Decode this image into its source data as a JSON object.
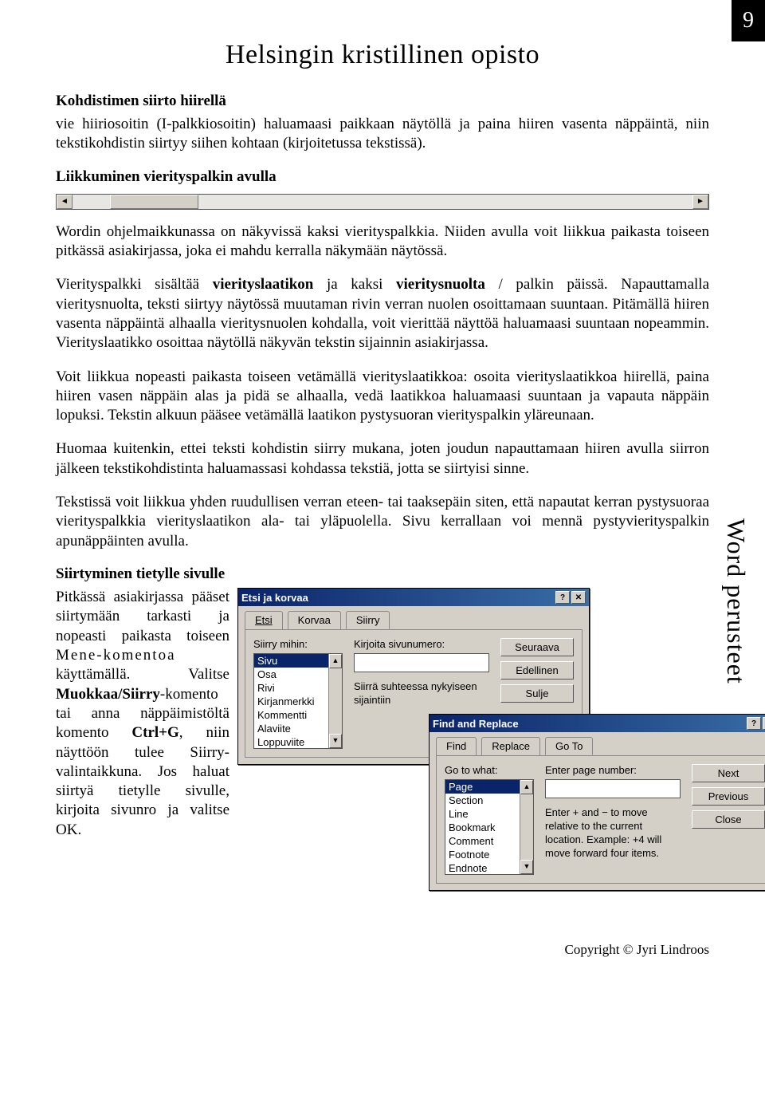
{
  "header": {
    "title": "Helsingin kristillinen opisto",
    "pageNumber": "9"
  },
  "sideText": "Word perusteet",
  "h1": "Kohdistimen siirto hiirellä",
  "p1": "vie hiiriosoitin (I-palkkiosoitin) haluamaasi paikkaan näytöllä ja paina hiiren vasenta näppäintä, niin tekstikohdistin siirtyy siihen kohtaan (kirjoitetussa tekstissä).",
  "h2": "Liikkuminen vierityspalkin avulla",
  "p2": "Wordin ohjelmaikkunassa on näkyvissä kaksi vierityspalkkia. Niiden avulla voit liikkua paikasta toiseen pitkässä asiakirjassa, joka ei mahdu kerralla näkymään näytössä.",
  "p3a": "Vierityspalkki sisältää ",
  "p3b": "vierityslaatikon",
  "p3c": "  ja kaksi ",
  "p3d": "vieritysnuolta",
  "p3e": "  / palkin päissä. Napauttamalla vieritysnuolta, teksti siirtyy näytössä muutaman rivin verran nuolen osoittamaan suuntaan. Pitämällä hiiren vasenta näppäintä alhaalla vieritysnuolen kohdalla, voit vierittää näyttöä haluamaasi suuntaan nopeammin. Vierityslaatikko osoittaa näytöllä näkyvän tekstin sijainnin asiakirjassa.",
  "p4": "Voit liikkua nopeasti paikasta toiseen vetämällä vierityslaatikkoa: osoita vierityslaatikkoa hiirellä, paina hiiren vasen näppäin alas ja pidä se alhaalla, vedä laatikkoa haluamaasi suuntaan ja vapauta näppäin lopuksi. Tekstin alkuun pääsee vetämällä laatikon pystysuoran vierityspalkin yläreunaan.",
  "p5": "Huomaa kuitenkin, ettei teksti kohdistin siirry mukana, joten joudun napauttamaan hiiren avulla siirron jälkeen tekstikohdistinta haluamassasi kohdassa tekstiä, jotta se siirtyisi sinne.",
  "p6": "Tekstissä voit liikkua yhden ruudullisen verran eteen- tai taaksepäin siten, että napautat kerran pystysuoraa vierityspalkkia vierityslaatikon ala- tai yläpuolella. Sivu kerrallaan voi mennä pystyvierityspalkin apunäppäinten  avulla.",
  "h3": "Siirtyminen tietylle sivulle",
  "left1": "Pitkässä asiakirjassa pääset siirtymään tarkasti ja nopeasti paikasta toiseen ",
  "left1b": "Mene-komentoa",
  "left1c": " käyttämällä. Valitse ",
  "left1d": "Muokkaa/Siirry",
  "left1e": "-komento tai anna näppäimistöltä komento ",
  "left1f": "Ctrl+G",
  "left1g": ", niin näyttöön tulee Siirry-valintaikkuna. Jos haluat siirtyä tietylle sivulle, kirjoita sivunro ja valitse OK.",
  "dlgFi": {
    "title": "Etsi ja korvaa",
    "tabs": [
      "Etsi",
      "Korvaa",
      "Siirry"
    ],
    "goLabel": "Siirry mihin:",
    "items": [
      "Sivu",
      "Osa",
      "Rivi",
      "Kirjanmerkki",
      "Kommentti",
      "Alaviite",
      "Loppuviite"
    ],
    "numLabel": "Kirjoita sivunumero:",
    "hint": "Siirrä suhteessa nykyiseen sijaintiin",
    "btnNext": "Seuraava",
    "btnPrev": "Edellinen",
    "btnClose": "Sulje"
  },
  "dlgEn": {
    "title": "Find and Replace",
    "tabs": [
      "Find",
      "Replace",
      "Go To"
    ],
    "goLabel": "Go to what:",
    "items": [
      "Page",
      "Section",
      "Line",
      "Bookmark",
      "Comment",
      "Footnote",
      "Endnote"
    ],
    "numLabel": "Enter page number:",
    "hint": "Enter + and − to move relative to the current location. Example: +4 will move forward four items.",
    "btnNext": "Next",
    "btnPrev": "Previous",
    "btnClose": "Close"
  },
  "copyright": "Copyright © Jyri Lindroos"
}
